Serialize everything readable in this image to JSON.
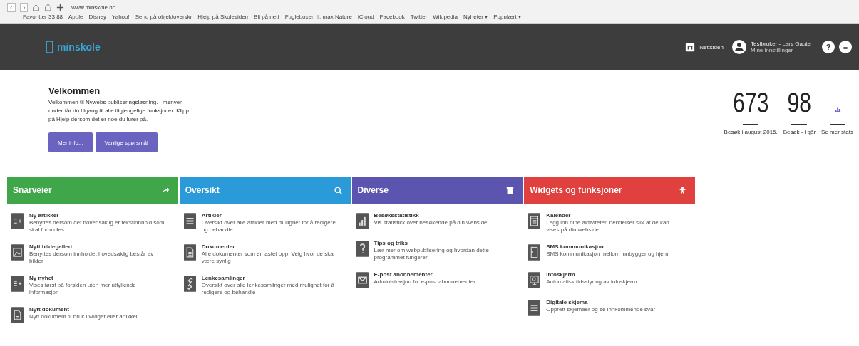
{
  "browser": {
    "back": "‹",
    "forward": "›",
    "url": "www.minskole.no",
    "bookmarks": [
      "Favoritter 33 88",
      "Apple",
      "Disney",
      "Yahoo!",
      "Send på objektoverskr",
      "Hjelp på Skolesiden",
      "Bli på nett",
      "Fugleboxen II, max Nature",
      "iCloud",
      "Facebook",
      "Twitter",
      "Wikipedia",
      "Nyheter ▾",
      "Populært ▾"
    ]
  },
  "header": {
    "logo": "minskole",
    "website_link": "Nettsiden",
    "user_name": "Testbruker - Lars Gaute",
    "user_sub": "Mine innstillinger",
    "help": "?",
    "menu": "≡"
  },
  "welcome": {
    "title": "Velkommen",
    "text": "Velkommen til Nywebs publiseringsløsning. I menyen under får du tilgang til alle tilgjengelige funksjoner. Klipp på Hjelp dersom det er noe du lurer på.",
    "buttons": [
      "Mer info...",
      "Vanlige spørsmål"
    ]
  },
  "stats": [
    {
      "value": "673",
      "label": "Besøk i august 2015."
    },
    {
      "value": "98",
      "label": "Besøk - i går"
    },
    {
      "label": "Se mer stats"
    }
  ],
  "columns": [
    {
      "title": "Snarveier",
      "color": "#3fa64a",
      "items": [
        {
          "title": "Ny artikkel",
          "text": "Benyttes dersom det hovedsaklig er tekstinnhold som skal formidles"
        },
        {
          "title": "Nytt bildegalleri",
          "text": "Benyttes dersom innholdet hovedsaklig består av bilder"
        },
        {
          "title": "Ny nyhet",
          "text": "Vises først på forsiden uten mer utfyllende informasjon"
        },
        {
          "title": "Nytt dokument",
          "text": "Nytt dokument til bruk i widget eller artikkel"
        }
      ]
    },
    {
      "title": "Oversikt",
      "color": "#2a9bd8",
      "items": [
        {
          "title": "Artikler",
          "text": "Oversikt over alle artikler med mulighet for å redigere og behandle"
        },
        {
          "title": "Dokumenter",
          "text": "Alle dokumenter som er lastet opp. Velg hvor de skal være synlig"
        },
        {
          "title": "Lenkesamlinger",
          "text": "Oversikt over alle lenkesamlinger med mulighet for å redigere og behandle"
        }
      ]
    },
    {
      "title": "Diverse",
      "color": "#5b55b0",
      "items": [
        {
          "title": "Besøksstatistikk",
          "text": "Vis statistikk over besøkende på din webside"
        },
        {
          "title": "Tips og triks",
          "text": "Lær mer om webpublisering og hvordan dette programmet fungerer"
        },
        {
          "title": "E-post abonnementer",
          "text": "Administrasjon for e-post abonnementer"
        }
      ]
    },
    {
      "title": "Widgets og funksjoner",
      "color": "#e0403e",
      "items": [
        {
          "title": "Kalender",
          "text": "Legg inn dine aktiviteter, hendelser slik at de kan vises på din webside"
        },
        {
          "title": "SMS kommunikasjon",
          "text": "SMS kommunikasjon mellom innbygger og hjem"
        },
        {
          "title": "Infoskjerm",
          "text": "Automatisk tidsstyring av infoskjerm"
        },
        {
          "title": "Digitale skjema",
          "text": "Opprett skjemaer og se innkommende svar"
        }
      ]
    }
  ]
}
